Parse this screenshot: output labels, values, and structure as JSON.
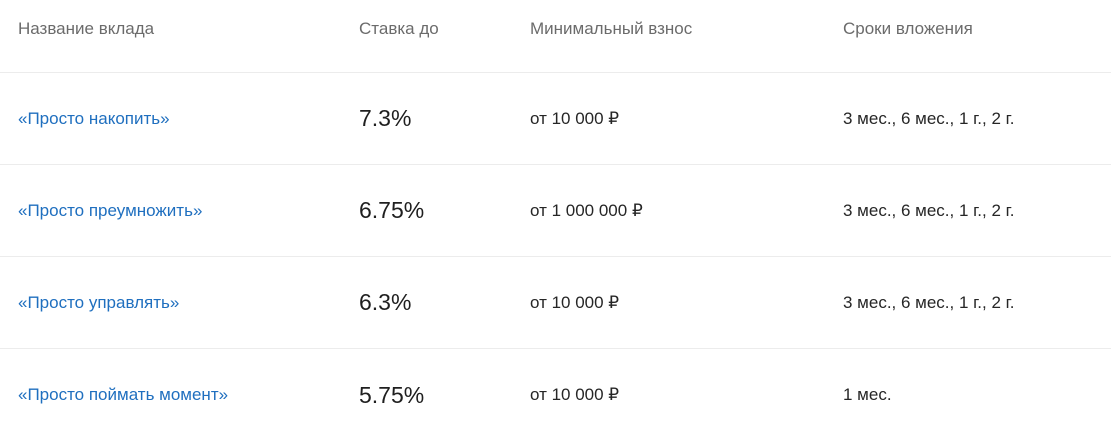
{
  "table": {
    "headers": {
      "name": "Название вклада",
      "rate": "Ставка до",
      "min": "Минимальный взнос",
      "term": "Сроки вложения"
    },
    "rows": [
      {
        "name": "«Просто накопить»",
        "rate": "7.3%",
        "min": "от 10 000 ₽",
        "term": "3 мес., 6 мес., 1 г., 2 г."
      },
      {
        "name": "«Просто преумножить»",
        "rate": "6.75%",
        "min": "от 1 000 000 ₽",
        "term": "3 мес., 6 мес., 1 г., 2 г."
      },
      {
        "name": "«Просто управлять»",
        "rate": "6.3%",
        "min": "от 10 000 ₽",
        "term": "3 мес., 6 мес., 1 г., 2 г."
      },
      {
        "name": "«Просто поймать момент»",
        "rate": "5.75%",
        "min": "от 10 000 ₽",
        "term": "1 мес."
      }
    ]
  },
  "colors": {
    "link": "#1f6fbf",
    "header_text": "#6b6b6b",
    "divider": "#ececec"
  }
}
